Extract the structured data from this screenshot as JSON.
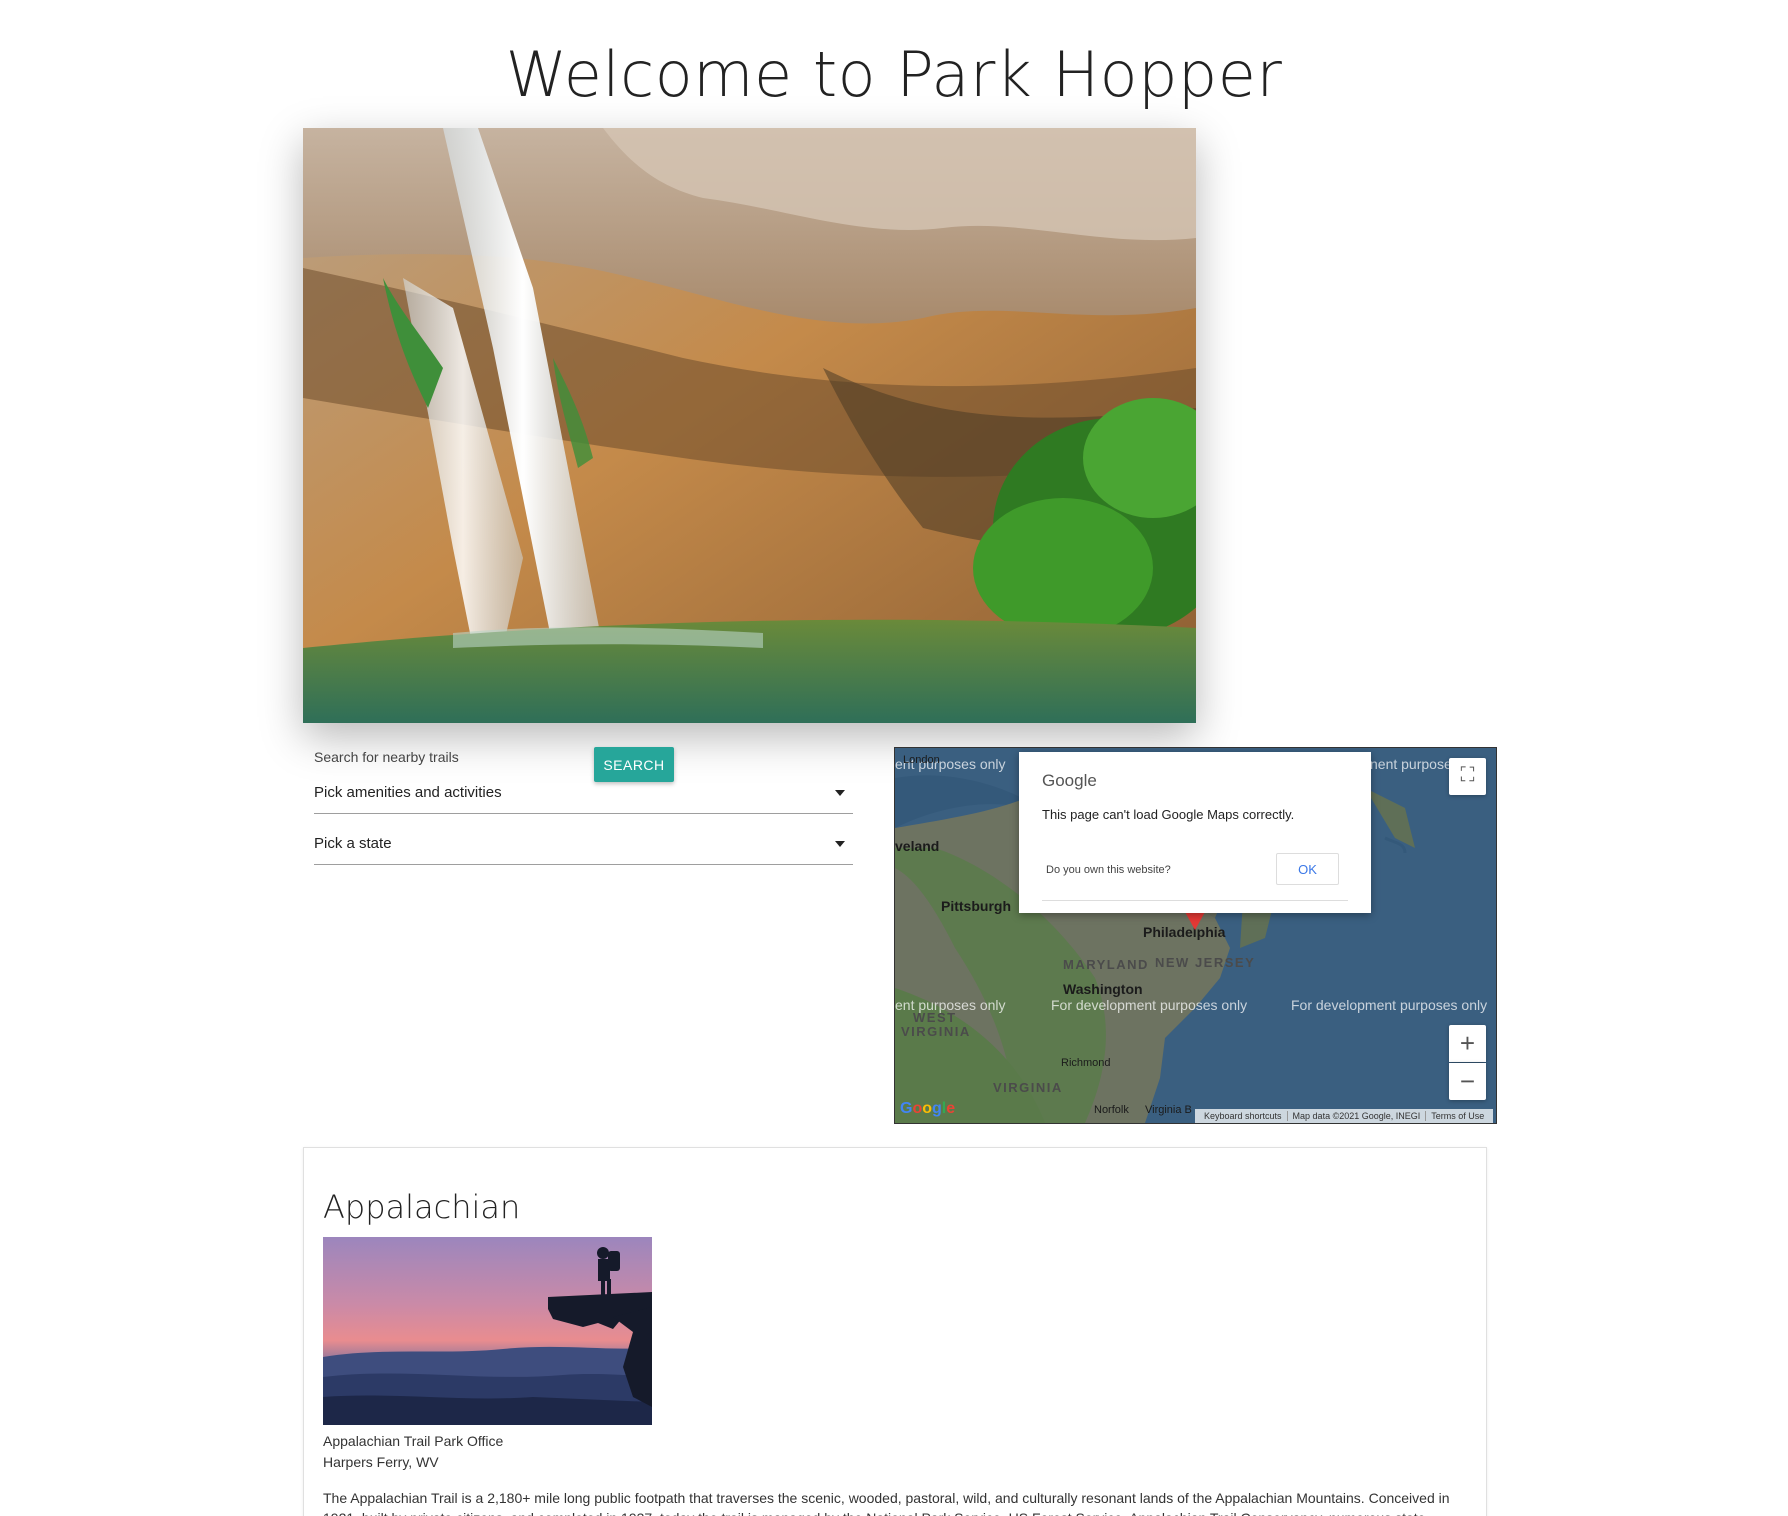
{
  "page": {
    "title": "Welcome to Park Hopper"
  },
  "search": {
    "label": "Search for nearby trails",
    "button_label": "SEARCH",
    "amenities_select": "Pick amenities and activities",
    "state_select": "Pick a state"
  },
  "map": {
    "dialog": {
      "brand": "Google",
      "message": "This page can't load Google Maps correctly.",
      "own_site": "Do you own this website?",
      "ok_label": "OK"
    },
    "watermark_full": "For development purposes only",
    "watermark_left": "ent purposes only",
    "watermark_right_top": "nent purpose",
    "cities": {
      "london": "London",
      "cleveland": "veland",
      "pittsburgh": "Pittsburgh",
      "philadelphia": "Philadelphia",
      "washington": "Washington",
      "richmond": "Richmond",
      "norfolk": "Norfolk",
      "virginia_beach": "Virginia B"
    },
    "states": {
      "maryland": "MARYLAND",
      "new_jersey": "NEW JERSEY",
      "west_virginia_1": "WEST",
      "west_virginia_2": "VIRGINIA",
      "virginia": "VIRGINIA"
    },
    "controls": {
      "zoom_in": "+",
      "zoom_out": "−",
      "fullscreen": "⛶"
    },
    "footer": {
      "shortcuts": "Keyboard shortcuts",
      "map_data": "Map data ©2021 Google, INEGI",
      "terms": "Terms of Use"
    },
    "google_mark": "Google"
  },
  "trail": {
    "name": "Appalachian",
    "office": "Appalachian Trail Park Office",
    "location": "Harpers Ferry, WV",
    "description": "The Appalachian Trail is a 2,180+ mile long public footpath that traverses the scenic, wooded, pastoral, wild, and culturally resonant lands of the Appalachian Mountains. Conceived in 1921, built by private citizens, and completed in 1937, today the trail is managed by the National Park Service, US Forest Service, Appalachian Trail Conservancy, numerous state"
  },
  "colors": {
    "accent": "#26a69a",
    "map_water": "#3a5f80",
    "ok_text": "#3b78e7",
    "pin": "#e53935"
  }
}
